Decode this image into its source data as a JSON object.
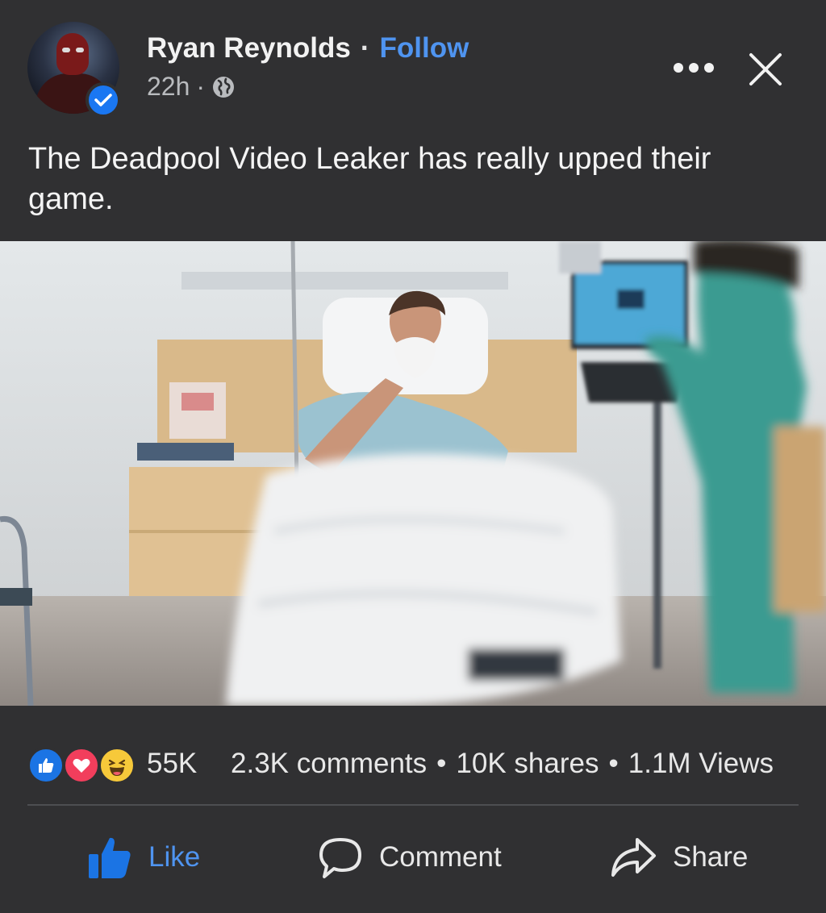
{
  "post": {
    "author": "Ryan Reynolds",
    "separator": "·",
    "follow_label": "Follow",
    "time": "22h",
    "time_separator": "·",
    "privacy_icon": "globe-icon",
    "caption": "The Deadpool Video Leaker has really upped their game."
  },
  "header_actions": {
    "more_icon": "more-dots-icon",
    "close_icon": "close-icon"
  },
  "stats": {
    "reaction_icons": [
      "like-reaction-icon",
      "love-reaction-icon",
      "haha-reaction-icon"
    ],
    "reaction_count": "55K",
    "comments": "2.3K comments",
    "bullet": "•",
    "shares": "10K shares",
    "views": "1.1M Views"
  },
  "actions": {
    "like_label": "Like",
    "comment_label": "Comment",
    "share_label": "Share"
  },
  "colors": {
    "background": "#303032",
    "accent_blue": "#4f94f0",
    "like_blue": "#1b74e4",
    "love_red": "#f23e5c",
    "haha_yellow": "#f7c93a"
  }
}
